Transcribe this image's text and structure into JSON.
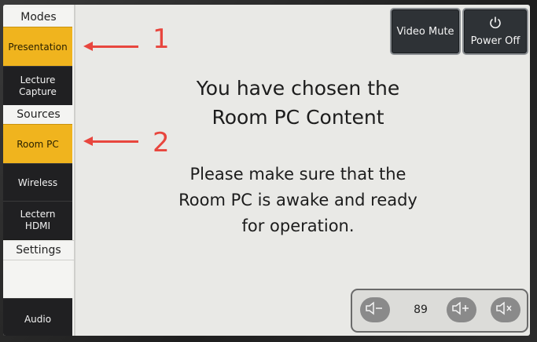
{
  "sidebar": {
    "modes_header": "Modes",
    "presentation": "Presentation",
    "lecture_capture_line1": "Lecture",
    "lecture_capture_line2": "Capture",
    "sources_header": "Sources",
    "room_pc": "Room PC",
    "wireless": "Wireless",
    "lectern_hdmi_line1": "Lectern",
    "lectern_hdmi_line2": "HDMI",
    "settings_header": "Settings",
    "audio": "Audio"
  },
  "top": {
    "video_mute": "Video Mute",
    "power_off": "Power Off"
  },
  "message": {
    "title_line1": "You have chosen the",
    "title_line2": "Room PC Content",
    "body_line1": "Please make sure that the",
    "body_line2": "Room PC is awake and ready",
    "body_line3": "for operation."
  },
  "volume": {
    "level": "89"
  },
  "annotations": {
    "marker1": "1",
    "marker2": "2",
    "color": "#e8463e"
  },
  "colors": {
    "active": "#f0b41e",
    "button_dark": "#202022",
    "screen_bg": "#e9e9e6"
  }
}
